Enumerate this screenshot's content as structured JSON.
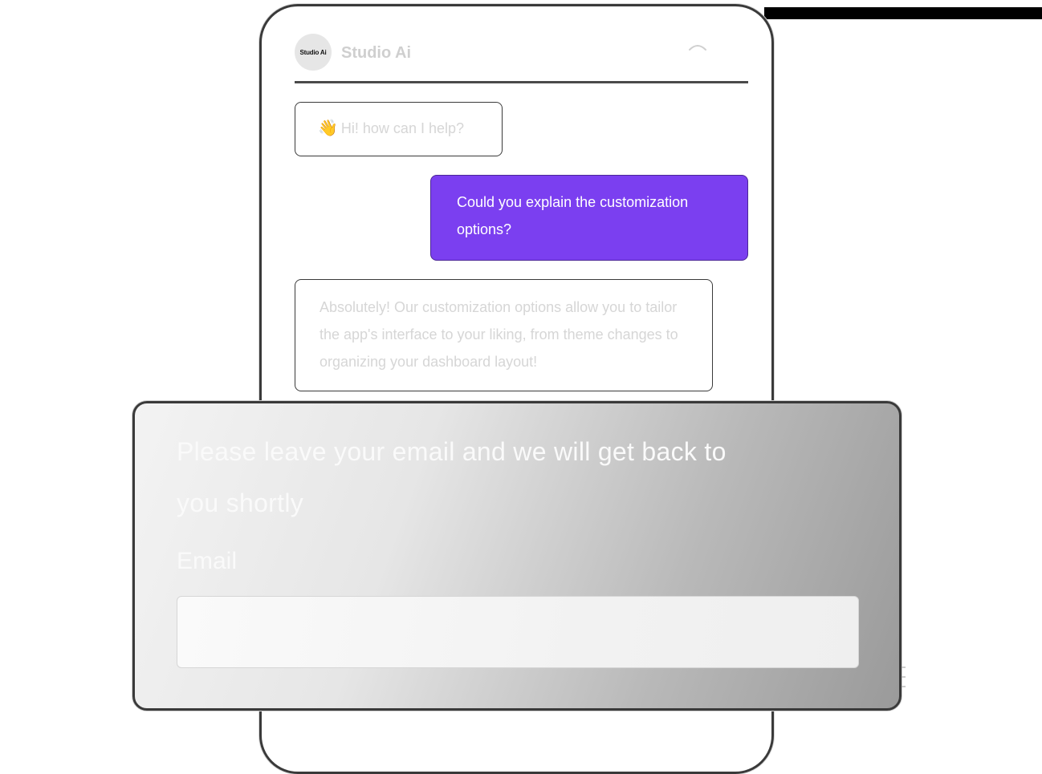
{
  "app": {
    "avatar_label": "Studio Ai",
    "name": "Studio Ai"
  },
  "chat": {
    "greeting": {
      "icon": "waving-hand-icon",
      "emoji": "👋",
      "text": "Hi! how can I help?"
    },
    "user_message": "Could you explain the customization options?",
    "bot_reply": "Absolutely! Our customization options allow you to tailor the app's interface to your liking, from theme changes to organizing your dashboard layout!"
  },
  "email_form": {
    "title": "Please leave your email and we will get back to you shortly",
    "email_label": "Email",
    "email_value": "",
    "email_placeholder": ""
  },
  "colors": {
    "accent": "#7b3ff0",
    "frame": "#3a3a3a",
    "bot_text": "#d6d6d6"
  }
}
